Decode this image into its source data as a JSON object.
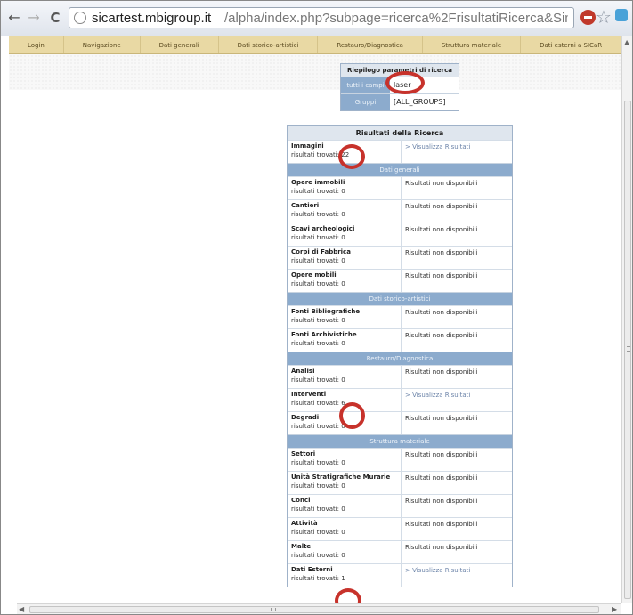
{
  "browser": {
    "back": "←",
    "forward": "→",
    "reload": "C",
    "url_host": "sicartest.mbigroup.it",
    "url_path": "/alpha/index.php?subpage=ricerca%2FrisultatiRicerca&SimpleSearch",
    "star": "☆"
  },
  "site_nav": [
    "Login",
    "Navigazione",
    "Dati generali",
    "Dati storico-artistici",
    "Restauro/Diagnostica",
    "Struttura materiale",
    "Dati esterni a SICaR"
  ],
  "params": {
    "title": "Riepilogo parametri di ricerca",
    "rows": [
      {
        "label": "tutti i campi",
        "value": "laser"
      },
      {
        "label": "Gruppi",
        "value": "[ALL_GROUPS]"
      }
    ]
  },
  "results": {
    "title": "Risultati della Ricerca",
    "count_prefix": "risultati trovati:",
    "top": {
      "name": "Immagini",
      "count": "22",
      "status": "> Visualizza Risultati"
    },
    "sections": [
      {
        "title": "Dati generali",
        "rows": [
          {
            "name": "Opere immobili",
            "count": "0",
            "status": "Risultati non disponibili"
          },
          {
            "name": "Cantieri",
            "count": "0",
            "status": "Risultati non disponibili"
          },
          {
            "name": "Scavi archeologici",
            "count": "0",
            "status": "Risultati non disponibili"
          },
          {
            "name": "Corpi di Fabbrica",
            "count": "0",
            "status": "Risultati non disponibili"
          },
          {
            "name": "Opere mobili",
            "count": "0",
            "status": "Risultati non disponibili"
          }
        ]
      },
      {
        "title": "Dati storico-artistici",
        "rows": [
          {
            "name": "Fonti Bibliografiche",
            "count": "0",
            "status": "Risultati non disponibili"
          },
          {
            "name": "Fonti Archivistiche",
            "count": "0",
            "status": "Risultati non disponibili"
          }
        ]
      },
      {
        "title": "Restauro/Diagnostica",
        "rows": [
          {
            "name": "Analisi",
            "count": "0",
            "status": "Risultati non disponibili"
          },
          {
            "name": "Interventi",
            "count": "6",
            "status": "> Visualizza Risultati"
          },
          {
            "name": "Degradi",
            "count": "0",
            "status": "Risultati non disponibili"
          }
        ]
      },
      {
        "title": "Struttura materiale",
        "rows": [
          {
            "name": "Settori",
            "count": "0",
            "status": "Risultati non disponibili"
          },
          {
            "name": "Unità Stratigrafiche Murarie",
            "count": "0",
            "status": "Risultati non disponibili"
          },
          {
            "name": "Conci",
            "count": "0",
            "status": "Risultati non disponibili"
          },
          {
            "name": "Attività",
            "count": "0",
            "status": "Risultati non disponibili"
          },
          {
            "name": "Malte",
            "count": "0",
            "status": "Risultati non disponibili"
          }
        ]
      }
    ],
    "bottom": {
      "name": "Dati Esterni",
      "count": "1",
      "status": "> Visualizza Risultati"
    }
  },
  "colors": {
    "accent_ring": "#c7322b",
    "section_header": "#8cabcd",
    "nav_bar": "#e9d9a4"
  }
}
